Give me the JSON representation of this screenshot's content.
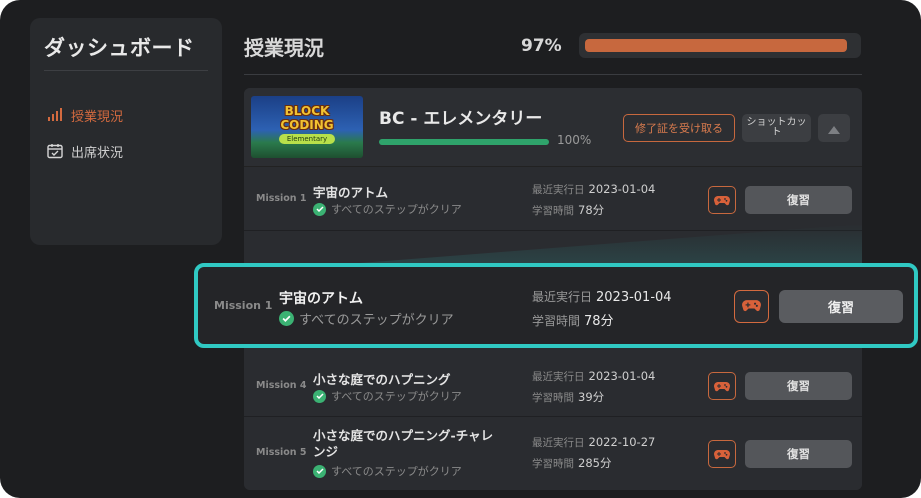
{
  "sidebar": {
    "title": "ダッシュボード",
    "items": [
      {
        "label": "授業現況",
        "icon": "bar-chart-icon",
        "active": true
      },
      {
        "label": "出席状況",
        "icon": "calendar-check-icon",
        "active": false
      }
    ]
  },
  "header": {
    "title": "授業現況",
    "overall_percent_label": "97%",
    "overall_progress": 0.97
  },
  "course": {
    "thumbnail": {
      "line1": "BLOCK",
      "line2": "CODING",
      "line3": "Elementary"
    },
    "name": "BC - エレメンタリー",
    "progress": 1.0,
    "progress_label": "100%",
    "certificate_button": "修了証を受け取る",
    "shortcut_button": "ショットカット",
    "collapse_icon": "chevron-up-icon"
  },
  "missions": [
    {
      "label": "Mission 1",
      "title": "宇宙のアトム",
      "status": "すべてのステップがクリア",
      "date_key": "最近実行日",
      "date": "2023-01-04",
      "time_key": "学習時間",
      "time": "78分",
      "review": "復習"
    },
    {
      "label": "Mission 4",
      "title": "小さな庭でのハプニング",
      "status": "すべてのステップがクリア",
      "date_key": "最近実行日",
      "date": "2023-01-04",
      "time_key": "学習時間",
      "time": "39分",
      "review": "復習"
    },
    {
      "label": "Mission 5",
      "title": "小さな庭でのハプニング-チャレンジ",
      "status": "すべてのステップがクリア",
      "date_key": "最近実行日",
      "date": "2022-10-27",
      "time_key": "学習時間",
      "time": "285分",
      "review": "復習"
    }
  ],
  "highlight": {
    "label": "Mission 1",
    "title": "宇宙のアトム",
    "status": "すべてのステップがクリア",
    "date_key": "最近実行日",
    "date": "2023-01-04",
    "time_key": "学習時間",
    "time": "78分",
    "review": "復習"
  },
  "colors": {
    "accent": "#c7683e",
    "success": "#3bb273",
    "highlight_border": "#30c9c3"
  }
}
